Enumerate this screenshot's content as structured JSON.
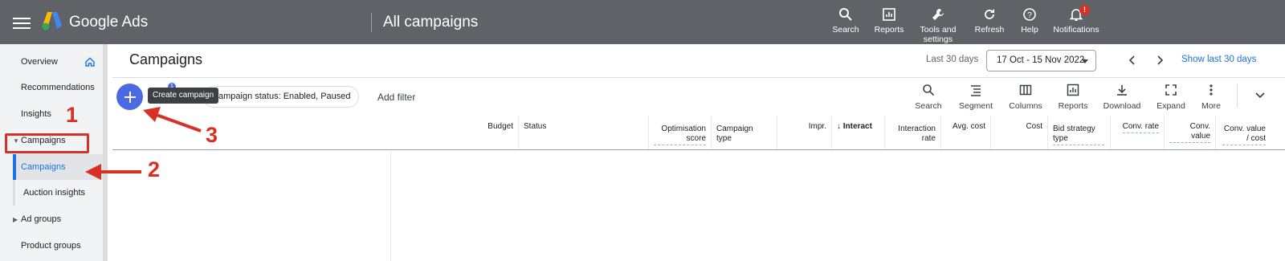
{
  "app": {
    "brand": "Google Ads",
    "page_title": "All campaigns"
  },
  "top_actions": [
    {
      "id": "search",
      "label": "Search",
      "icon": "search-icon"
    },
    {
      "id": "reports",
      "label": "Reports",
      "icon": "reports-icon"
    },
    {
      "id": "tools",
      "label": "Tools and settings",
      "icon": "wrench-icon"
    },
    {
      "id": "refresh",
      "label": "Refresh",
      "icon": "refresh-icon"
    },
    {
      "id": "help",
      "label": "Help",
      "icon": "help-icon"
    },
    {
      "id": "notifications",
      "label": "Notifications",
      "icon": "bell-icon",
      "badge": "!"
    }
  ],
  "sidebar": {
    "items": [
      {
        "label": "Overview"
      },
      {
        "label": "Recommendations"
      },
      {
        "label": "Insights"
      },
      {
        "label": "Campaigns"
      },
      {
        "label": "Campaigns"
      },
      {
        "label": "Auction insights"
      },
      {
        "label": "Ad groups"
      },
      {
        "label": "Product groups"
      }
    ]
  },
  "content": {
    "title": "Campaigns",
    "date_label": "Last 30 days",
    "date_range": "17 Oct - 15 Nov 2022",
    "show_last": "Show last 30 days"
  },
  "filter": {
    "badge": "1",
    "tooltip": "Create campaign",
    "chip": "ampaign status: Enabled, Paused",
    "add_filter": "Add filter"
  },
  "tools": [
    {
      "label": "Search",
      "icon": "search-icon"
    },
    {
      "label": "Segment",
      "icon": "segment-icon"
    },
    {
      "label": "Columns",
      "icon": "columns-icon"
    },
    {
      "label": "Reports",
      "icon": "reports-icon"
    },
    {
      "label": "Download",
      "icon": "download-icon"
    },
    {
      "label": "Expand",
      "icon": "expand-icon"
    },
    {
      "label": "More",
      "icon": "more-vert-icon"
    }
  ],
  "table": {
    "columns": [
      {
        "label": "Budget"
      },
      {
        "label": "Status"
      },
      {
        "label": "Optimisation score"
      },
      {
        "label": "Campaign type"
      },
      {
        "label": "Impr."
      },
      {
        "label": "Interact"
      },
      {
        "label": "Interaction rate"
      },
      {
        "label": "Avg. cost"
      },
      {
        "label": "Cost"
      },
      {
        "label": "Bid strategy type"
      },
      {
        "label": "Conv. rate"
      },
      {
        "label": "Conv. value"
      },
      {
        "label": "Conv. value / cost"
      }
    ]
  },
  "annotations": {
    "n1": "1",
    "n2": "2",
    "n3": "3",
    "color": "#d93025"
  },
  "colors": {
    "topbar": "#5f6368",
    "accent": "#1a73e8",
    "fab": "#4a69e2"
  }
}
